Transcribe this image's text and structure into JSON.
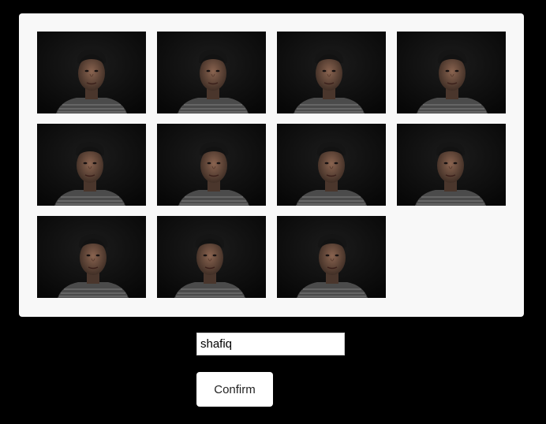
{
  "gallery": {
    "photos": [
      {
        "icon": "face-photo"
      },
      {
        "icon": "face-photo"
      },
      {
        "icon": "face-photo"
      },
      {
        "icon": "face-photo"
      },
      {
        "icon": "face-photo"
      },
      {
        "icon": "face-photo"
      },
      {
        "icon": "face-photo"
      },
      {
        "icon": "face-photo"
      },
      {
        "icon": "face-photo"
      },
      {
        "icon": "face-photo"
      },
      {
        "icon": "face-photo"
      }
    ]
  },
  "form": {
    "name_value": "shafiq",
    "confirm_label": "Confirm"
  },
  "colors": {
    "background": "#000000",
    "panel": "#f8f8f8",
    "button": "#ffffff"
  }
}
